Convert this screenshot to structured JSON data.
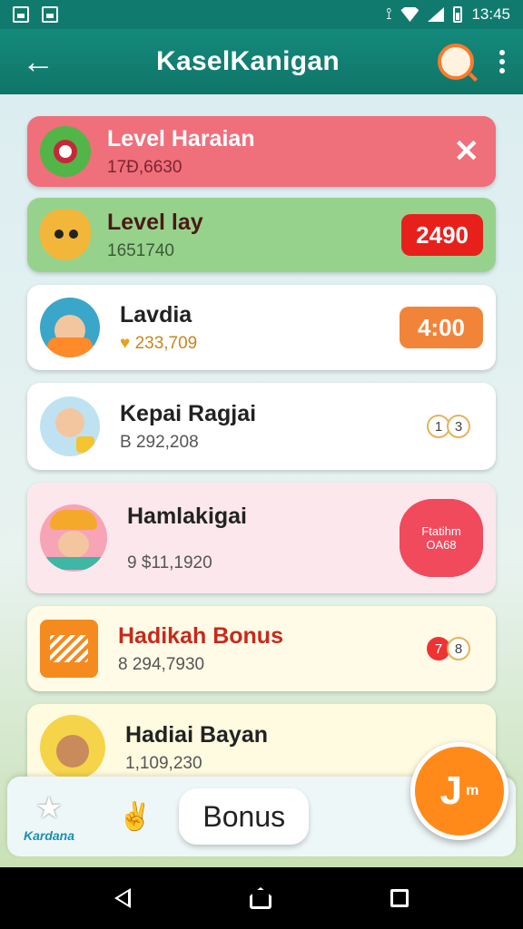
{
  "status_bar": {
    "time": "13:45"
  },
  "app_bar": {
    "title": "KaselKanigan"
  },
  "items": [
    {
      "title": "Level Haraian",
      "subtitle": "17Ð,6630",
      "icon": "monster-icon",
      "action": "✕"
    },
    {
      "title": "Level lay",
      "subtitle": "1651740",
      "icon": "dog-icon",
      "badge": "2490",
      "badge_color": "#e8201c"
    },
    {
      "title": "Lavdia",
      "subtitle": "233,709",
      "icon": "man-avatar-icon",
      "badge": "4:00",
      "badge_color": "#f2843a"
    },
    {
      "title": "Kepai Ragjai",
      "subtitle": "B 292,208",
      "icon": "boy-avatar-icon",
      "coins": [
        "1",
        "3"
      ]
    },
    {
      "title": "Hamlakigai",
      "subtitle": "9 $11,1920",
      "icon": "turban-avatar-icon",
      "seal_text": "Ftatihm OA68"
    },
    {
      "title": "Hadikah Bonus",
      "subtitle": "8 294,7930",
      "icon": "gift-box-icon",
      "coins": [
        "7",
        "8"
      ]
    },
    {
      "title": "Hadiai Bayan",
      "subtitle": "1,109,230",
      "icon": "cheer-avatar-icon"
    }
  ],
  "bottom_bar": {
    "nav_label": "Kardana",
    "bonus_label": "Bonus",
    "fab_label": "J",
    "fab_small": "m"
  },
  "colors": {
    "primary": "#117a6e",
    "accent": "#ff8a1a",
    "red": "#e8201c"
  }
}
